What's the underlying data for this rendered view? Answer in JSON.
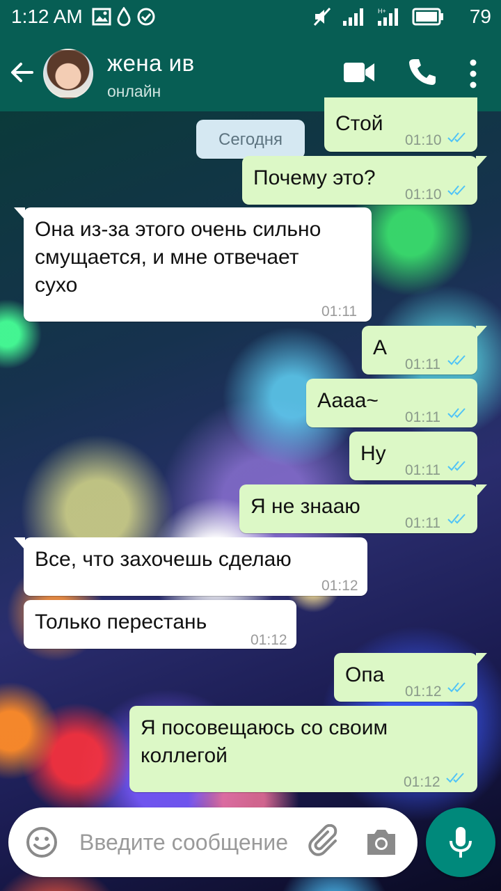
{
  "status_bar": {
    "time": "1:12 AM",
    "battery": "79",
    "icons": [
      "image-icon",
      "drop-icon",
      "check-circle-icon",
      "mute-icon",
      "signal-icon",
      "signal-h-plus-icon",
      "battery-icon"
    ]
  },
  "header": {
    "contact_name": "жена ив",
    "contact_status": "онлайн",
    "icons": [
      "back-arrow-icon",
      "video-call-icon",
      "phone-icon",
      "more-vert-icon"
    ]
  },
  "date_separator": "Сегодня",
  "messages": [
    {
      "dir": "out",
      "text": "Стой",
      "time": "01:10",
      "read": true
    },
    {
      "dir": "out",
      "text": "Почему это?",
      "time": "01:10",
      "read": true
    },
    {
      "dir": "in",
      "text": "Она из-за этого очень сильно\nсмущается, и мне отвечает\nсухо",
      "time": "01:11"
    },
    {
      "dir": "out",
      "text": "А",
      "time": "01:11",
      "read": true
    },
    {
      "dir": "out",
      "text": "Аааа~",
      "time": "01:11",
      "read": true
    },
    {
      "dir": "out",
      "text": "Ну",
      "time": "01:11",
      "read": true
    },
    {
      "dir": "out",
      "text": "Я не знааю",
      "time": "01:11",
      "read": true
    },
    {
      "dir": "in",
      "text": "Все, что захочешь сделаю",
      "time": "01:12"
    },
    {
      "dir": "in",
      "text": "Только перестань",
      "time": "01:12"
    },
    {
      "dir": "out",
      "text": "Опа",
      "time": "01:12",
      "read": true
    },
    {
      "dir": "out",
      "text": "Я посовещаюсь со своим\nколлегой",
      "time": "01:12",
      "read": true
    }
  ],
  "composer": {
    "placeholder": "Введите сообщение"
  },
  "colors": {
    "header": "#075e54",
    "outgoing_bubble": "#dcf8c6",
    "incoming_bubble": "#ffffff",
    "read_ticks": "#4fc3f7",
    "mic_button": "#00897b"
  }
}
